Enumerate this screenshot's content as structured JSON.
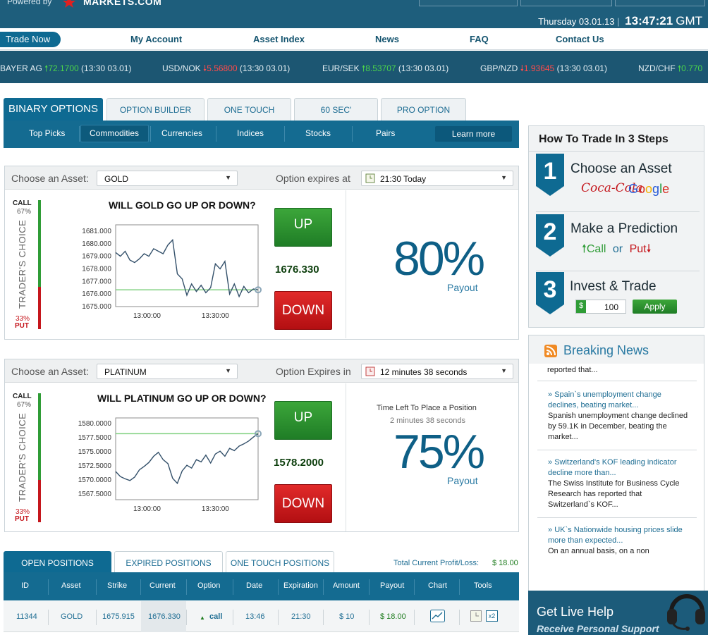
{
  "header": {
    "powered_by": "Powered by",
    "brand": "MARKETS.COM",
    "date": "Thursday 03.01.13",
    "separator": "|",
    "time": "13:47:21",
    "tz": "GMT"
  },
  "nav": {
    "trade_now": "Trade Now",
    "links": [
      "My Account",
      "Asset Index",
      "News",
      "FAQ",
      "Contact Us"
    ]
  },
  "ticker": [
    {
      "name": "BAYER AG",
      "dir": "up",
      "value": "72.1700",
      "time": "(13:30 03.01)"
    },
    {
      "name": "USD/NOK",
      "dir": "down",
      "value": "5.56800",
      "time": "(13:30 03.01)"
    },
    {
      "name": "EUR/SEK",
      "dir": "up",
      "value": "8.53707",
      "time": "(13:30 03.01)"
    },
    {
      "name": "GBP/NZD",
      "dir": "down",
      "value": "1.93645",
      "time": "(13:30 03.01)"
    },
    {
      "name": "NZD/CHF",
      "dir": "up",
      "value": "0.770",
      "time": ""
    }
  ],
  "tabs": [
    "BINARY OPTIONS",
    "OPTION BUILDER",
    "ONE TOUCH",
    "60 SEC'",
    "PRO OPTION"
  ],
  "subtabs": [
    "Top Picks",
    "Commodities",
    "Currencies",
    "Indices",
    "Stocks",
    "Pairs"
  ],
  "learn_more": "Learn more",
  "panel1": {
    "choose_label": "Choose an Asset:",
    "asset": "GOLD",
    "expiry_label": "Option expires at",
    "expiry": "21:30 Today",
    "question": "WILL GOLD GO UP OR DOWN?",
    "call_label": "CALL",
    "call_pct": "67%",
    "put_pct": "33%",
    "put_label": "PUT",
    "traders_choice": "TRADER'S CHOICE",
    "up": "UP",
    "down": "DOWN",
    "price": "1676.330",
    "payout_pct": "80%",
    "payout_label": "Payout"
  },
  "panel2": {
    "choose_label": "Choose an Asset:",
    "asset": "PLATINUM",
    "expiry_label": "Option Expires in",
    "expiry": "12 minutes 38 seconds",
    "question": "WILL PLATINUM GO UP OR DOWN?",
    "call_label": "CALL",
    "call_pct": "67%",
    "put_pct": "33%",
    "put_label": "PUT",
    "traders_choice": "TRADER'S CHOICE",
    "up": "UP",
    "down": "DOWN",
    "price": "1578.2000",
    "time_left_label": "Time Left To Place a Position",
    "time_left": "2 minutes 38 seconds",
    "payout_pct": "75%",
    "payout_label": "Payout"
  },
  "chart_data": [
    {
      "type": "line",
      "title": "WILL GOLD GO UP OR DOWN?",
      "y_ticks": [
        "1681.000",
        "1680.000",
        "1679.000",
        "1678.000",
        "1677.000",
        "1676.000",
        "1675.000"
      ],
      "x_ticks": [
        "13:00:00",
        "13:30:00"
      ],
      "ylim": [
        1675.0,
        1681.5
      ],
      "x": [
        0,
        2,
        4,
        6,
        8,
        10,
        12,
        14,
        16,
        18,
        20,
        22,
        24,
        26,
        28,
        30,
        32,
        34,
        36,
        38,
        40,
        42,
        44,
        46,
        48,
        50,
        52,
        54,
        56,
        58,
        60
      ],
      "values": [
        1679.3,
        1679.0,
        1679.4,
        1678.7,
        1678.5,
        1678.8,
        1679.2,
        1679.0,
        1679.6,
        1679.4,
        1679.2,
        1679.9,
        1680.3,
        1677.6,
        1677.2,
        1675.9,
        1676.8,
        1676.2,
        1676.7,
        1676.1,
        1676.5,
        1678.4,
        1678.0,
        1678.6,
        1676.0,
        1676.8,
        1675.8,
        1676.6,
        1676.1,
        1676.4,
        1676.33
      ],
      "reference": 1676.33
    },
    {
      "type": "line",
      "title": "WILL PLATINUM GO UP OR DOWN?",
      "y_ticks": [
        "1580.0000",
        "1577.5000",
        "1575.0000",
        "1572.5000",
        "1570.0000",
        "1567.5000"
      ],
      "x_ticks": [
        "13:00:00",
        "13:30:00"
      ],
      "ylim": [
        1566.5,
        1581.0
      ],
      "x": [
        0,
        2,
        4,
        6,
        8,
        10,
        12,
        14,
        16,
        18,
        20,
        22,
        24,
        26,
        28,
        30,
        32,
        34,
        36,
        38,
        40,
        42,
        44,
        46,
        48,
        50,
        52,
        54,
        56,
        58,
        60
      ],
      "values": [
        1571.5,
        1570.6,
        1570.2,
        1569.9,
        1570.5,
        1571.8,
        1572.4,
        1573.1,
        1574.2,
        1574.9,
        1573.6,
        1572.9,
        1570.3,
        1569.4,
        1571.6,
        1572.6,
        1572.1,
        1573.6,
        1573.2,
        1574.4,
        1573.0,
        1574.6,
        1575.1,
        1574.2,
        1575.6,
        1575.2,
        1576.0,
        1576.4,
        1576.9,
        1577.6,
        1578.2
      ],
      "reference": 1578.2
    }
  ],
  "positions": {
    "tabs": [
      "OPEN POSITIONS",
      "EXPIRED POSITIONS",
      "ONE TOUCH POSITIONS"
    ],
    "pl_label": "Total Current Profit/Loss:",
    "pl_value": "$ 18.00",
    "columns": [
      "ID",
      "Asset",
      "Strike",
      "Current",
      "Option",
      "Date",
      "Expiration",
      "Amount",
      "Payout",
      "Chart",
      "Tools"
    ],
    "rows": [
      {
        "id": "11344",
        "asset": "GOLD",
        "strike": "1675.915",
        "current": "1676.330",
        "option": "call",
        "date": "13:46",
        "expiration": "21:30",
        "amount": "$ 10",
        "payout": "$ 18.00",
        "tool_x2": "x2"
      }
    ]
  },
  "steps": {
    "title": "How To Trade In 3 Steps",
    "items": [
      {
        "num": "1",
        "title": "Choose an Asset",
        "brand1": "Coca-Cola",
        "brand2": "Google"
      },
      {
        "num": "2",
        "title": "Make a Prediction",
        "call": "Call",
        "or": "or",
        "put": "Put"
      },
      {
        "num": "3",
        "title": "Invest & Trade",
        "currency": "$",
        "amount": "100",
        "apply": "Apply"
      }
    ]
  },
  "news": {
    "title": "Breaking News",
    "partial": "reported that...",
    "items": [
      {
        "headline": "Spain`s unemployment change declines, beating market...",
        "body": "Spanish unemployment change declined by 59.1K in December, beating the market..."
      },
      {
        "headline": "Switzerland's KOF leading indicator decline more than...",
        "body": "The Swiss Institute for Business Cycle Research has reported that Switzerland`s KOF..."
      },
      {
        "headline": "UK`s Nationwide housing prices slide more than expected...",
        "body": "On an annual basis, on a non"
      }
    ]
  },
  "livehelp": {
    "title": "Get Live Help",
    "subtitle": "Receive Personal Support"
  },
  "colors": {
    "brand": "#0e6a92",
    "up": "#2f9c36",
    "down": "#c5161c"
  }
}
